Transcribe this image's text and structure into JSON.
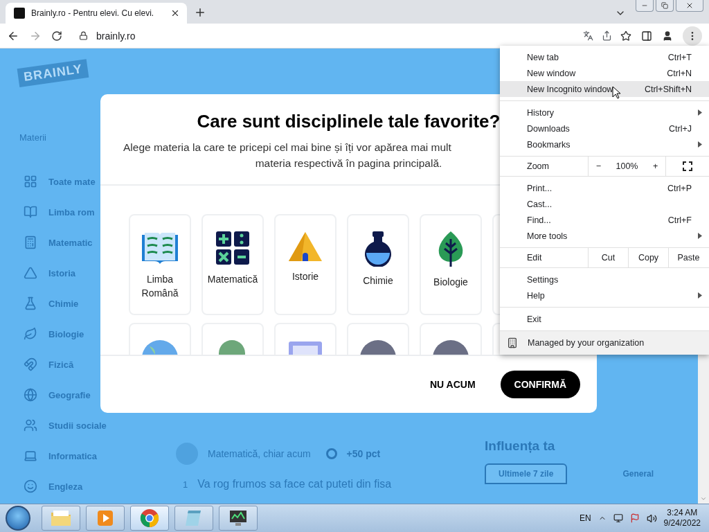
{
  "browser": {
    "tab": {
      "title": "Brainly.ro - Pentru elevi. Cu elevi.",
      "selected": true
    },
    "address": "brainly.ro"
  },
  "page": {
    "logo": "BRAINLY",
    "sidebar": {
      "heading": "Materii",
      "items": [
        {
          "label": "Toate mate",
          "kind": "grid"
        },
        {
          "label": "Limba rom",
          "kind": "book"
        },
        {
          "label": "Matematic",
          "kind": "calc"
        },
        {
          "label": "Istoria",
          "kind": "pyramid"
        },
        {
          "label": "Chimie",
          "kind": "flask"
        },
        {
          "label": "Biologie",
          "kind": "leaf"
        },
        {
          "label": "Fizică",
          "kind": "magnet"
        },
        {
          "label": "Geografie",
          "kind": "globe"
        },
        {
          "label": "Studii sociale",
          "kind": "people"
        },
        {
          "label": "Informatica",
          "kind": "laptop"
        },
        {
          "label": "Engleza",
          "kind": "face"
        }
      ]
    },
    "feed": {
      "subject": "Matematică, chiar acum",
      "points": "+50 pct",
      "number": "1",
      "question": "Va rog frumos sa face cat puteti din fisa"
    },
    "influence": {
      "title": "Influența ta",
      "tabs": [
        {
          "label": "Ultimele 7 zile",
          "selected": true
        },
        {
          "label": "General",
          "selected": false
        }
      ]
    }
  },
  "dialog": {
    "title": "Care sunt disciplinele tale favorite?",
    "subtitle_lines": [
      "Alege materia la care te pricepi cel mai bine și îți vor apărea mai mult",
      "materia respectivă în pagina principală."
    ],
    "subjects": [
      {
        "label": "Limba Română",
        "kind": "book"
      },
      {
        "label": "Matematică",
        "kind": "calc"
      },
      {
        "label": "Istorie",
        "kind": "pyramid"
      },
      {
        "label": "Chimie",
        "kind": "flask"
      },
      {
        "label": "Biologie",
        "kind": "leaf"
      },
      {
        "kind": "blank"
      }
    ],
    "more_subjects": [
      {
        "kind": "globe"
      },
      {
        "kind": "green"
      },
      {
        "kind": "square"
      },
      {
        "kind": "grey"
      },
      {
        "kind": "grey"
      },
      {
        "kind": "blank"
      }
    ],
    "buttons": [
      {
        "label": "NU ACUM",
        "kind": "text"
      },
      {
        "label": "CONFIRMĂ",
        "kind": "primary"
      }
    ]
  },
  "menu": {
    "sections": [
      [
        {
          "kind": "item",
          "label": "New tab",
          "shortcut": "Ctrl+T",
          "selected": false
        },
        {
          "kind": "item",
          "label": "New window",
          "shortcut": "Ctrl+N",
          "selected": false
        },
        {
          "kind": "item",
          "label": "New Incognito window",
          "shortcut": "Ctrl+Shift+N",
          "selected": true
        }
      ],
      [
        {
          "kind": "item",
          "label": "History",
          "submenu": true,
          "selected": false
        },
        {
          "kind": "item",
          "label": "Downloads",
          "shortcut": "Ctrl+J",
          "selected": false
        },
        {
          "kind": "item",
          "label": "Bookmarks",
          "submenu": true,
          "selected": false
        }
      ],
      [
        {
          "kind": "zoom",
          "label": "Zoom",
          "minus": "−",
          "value": "100%",
          "plus": "+"
        }
      ],
      [
        {
          "kind": "item",
          "label": "Print...",
          "shortcut": "Ctrl+P",
          "selected": false
        },
        {
          "kind": "item",
          "label": "Cast...",
          "selected": false
        },
        {
          "kind": "item",
          "label": "Find...",
          "shortcut": "Ctrl+F",
          "selected": false
        },
        {
          "kind": "item",
          "label": "More tools",
          "submenu": true,
          "selected": false
        }
      ],
      [
        {
          "kind": "edit",
          "label": "Edit",
          "actions": [
            "Cut",
            "Copy",
            "Paste"
          ]
        }
      ],
      [
        {
          "kind": "item",
          "label": "Settings",
          "selected": false
        },
        {
          "kind": "item",
          "label": "Help",
          "submenu": true,
          "selected": false
        }
      ],
      [
        {
          "kind": "item",
          "label": "Exit",
          "selected": false
        }
      ],
      [
        {
          "kind": "managed",
          "label": "Managed by your organization"
        }
      ]
    ]
  },
  "taskbar": {
    "apps": [
      {
        "kind": "explorer",
        "selected": false
      },
      {
        "kind": "media",
        "selected": false
      },
      {
        "kind": "chrome",
        "selected": true
      },
      {
        "kind": "notepad",
        "selected": false
      },
      {
        "kind": "monitor",
        "selected": false
      }
    ],
    "language": "EN",
    "time": "3:24 AM",
    "date": "9/24/2022"
  }
}
